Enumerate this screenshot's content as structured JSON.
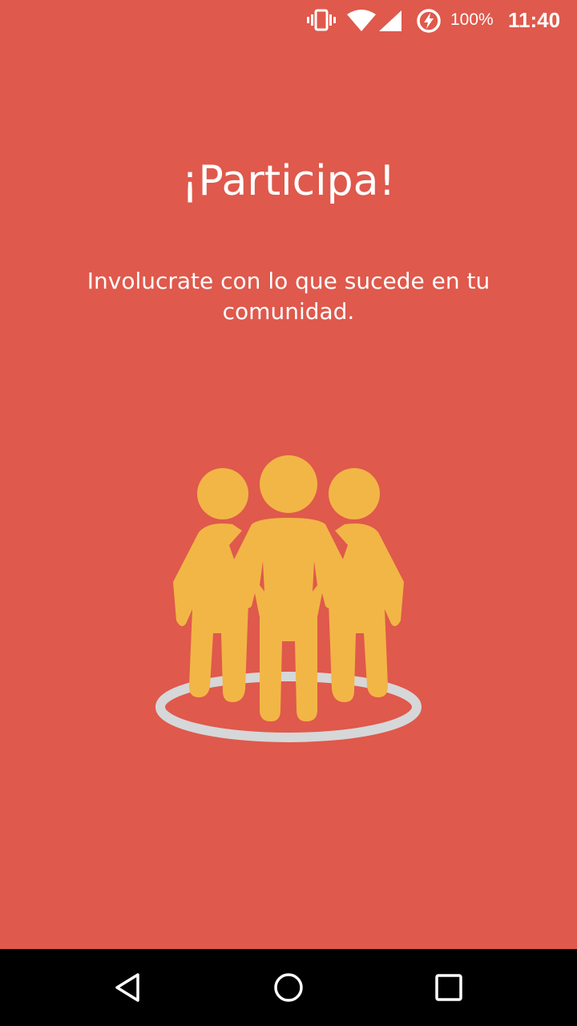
{
  "status_bar": {
    "battery_percent": "100%",
    "time": "11:40",
    "icons": [
      "vibrate-icon",
      "wifi-icon",
      "signal-icon",
      "battery-saver-icon"
    ]
  },
  "onboarding": {
    "title": "¡Participa!",
    "subtitle": "Involucrate con lo que sucede en tu comunidad.",
    "illustration": "community-people-icon"
  },
  "nav_bar": {
    "buttons": [
      "back-icon",
      "home-icon",
      "recents-icon"
    ]
  },
  "colors": {
    "background": "#DF594C",
    "figures": "#F2B646",
    "ring": "#D6D7D8",
    "nav_bar": "#000000"
  }
}
